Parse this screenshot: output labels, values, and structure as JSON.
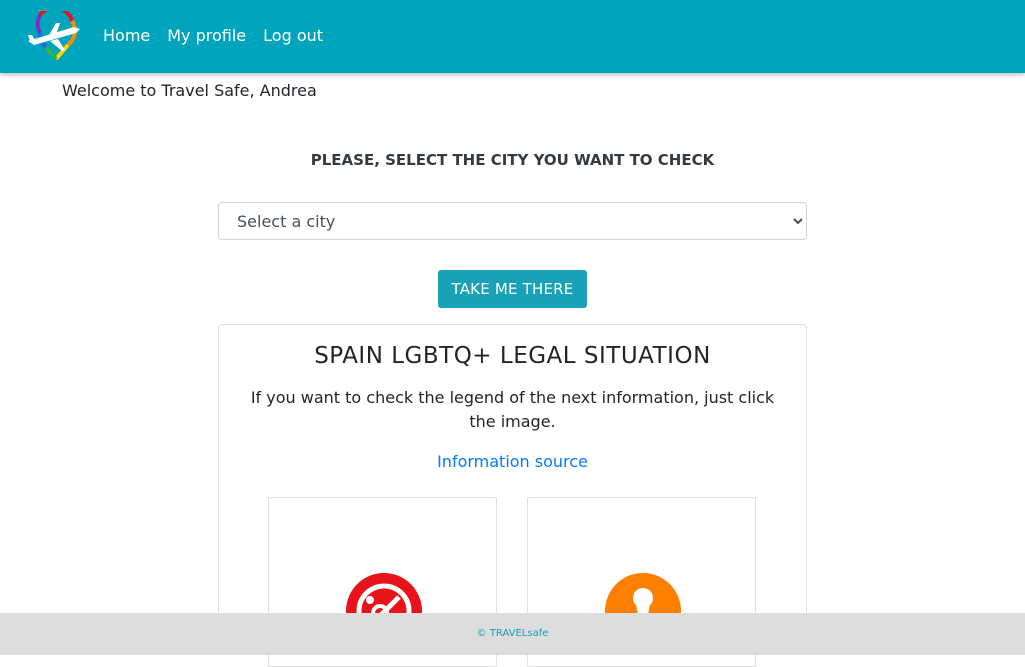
{
  "nav": {
    "logo_icon": "rainbow-plane-pin-logo",
    "links": [
      {
        "label": "Home"
      },
      {
        "label": "My profile"
      },
      {
        "label": "Log out"
      }
    ]
  },
  "welcome_text": "Welcome to Travel Safe, Andrea",
  "city_prompt": "PLEASE, SELECT THE CITY YOU WANT TO CHECK",
  "city_select": {
    "selected": "Select a city"
  },
  "go_button_label": "TAKE ME THERE",
  "legal_card": {
    "title": "SPAIN LGBTQ+ LEGAL SITUATION",
    "description": "If you want to check the legend of the next information, just click the image.",
    "source_link": "Information source",
    "items": [
      {
        "icon": "red-legal-status-icon",
        "color": "#e8141b"
      },
      {
        "icon": "orange-person-icon",
        "color": "#ff7f00"
      }
    ]
  },
  "footer_text": "© TRAVELsafe",
  "colors": {
    "navbar": "#00a5bd",
    "button": "#17a2b8",
    "link": "#007bff",
    "footer": "#dddddd"
  }
}
